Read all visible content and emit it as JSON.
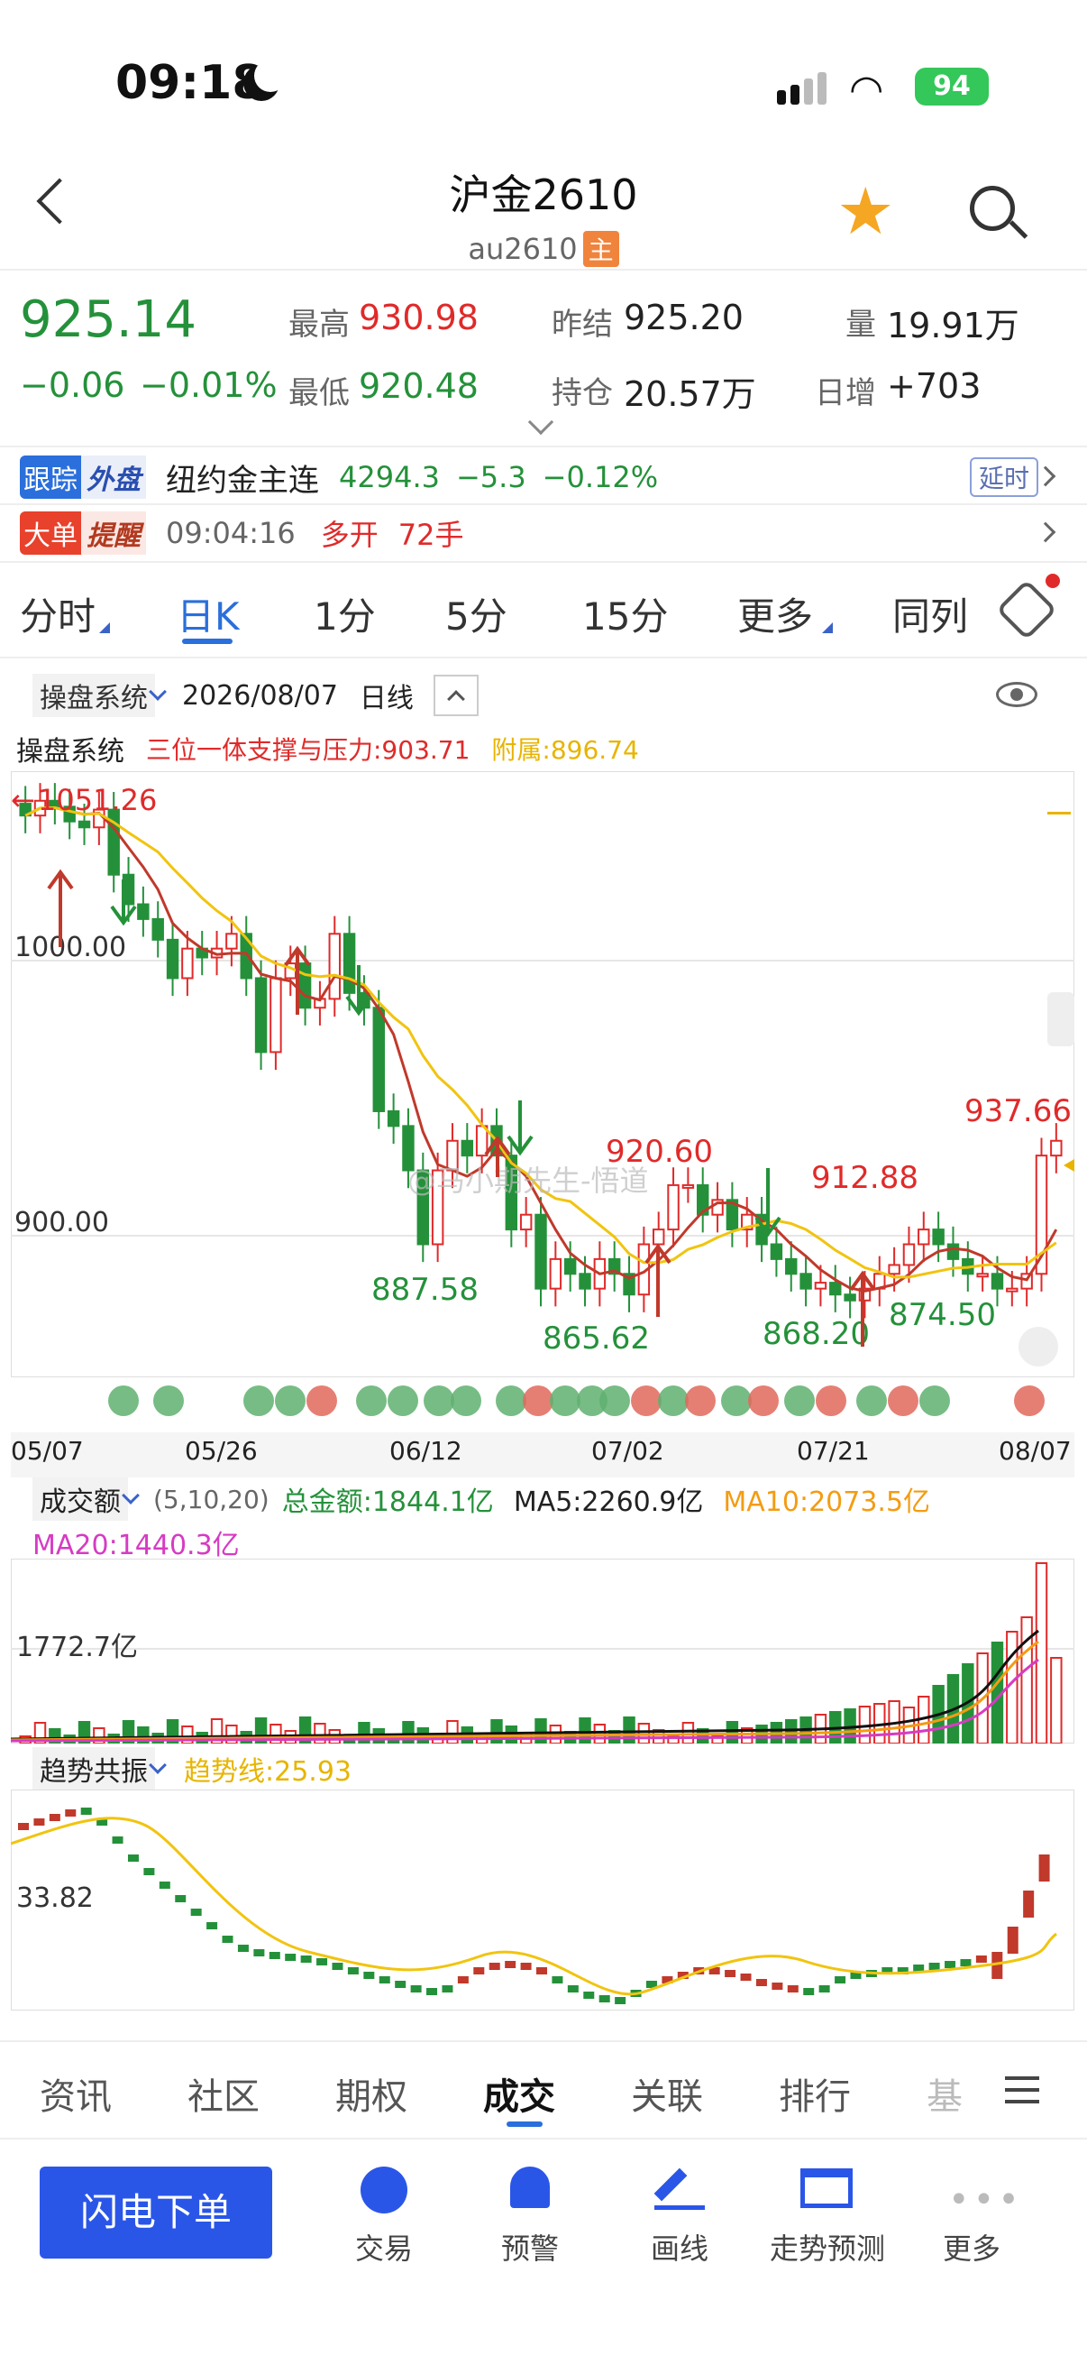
{
  "status": {
    "time": "09:18",
    "battery": "94"
  },
  "header": {
    "title": "沪金2610",
    "code": "au2610",
    "badge": "主"
  },
  "quote": {
    "price": "925.14",
    "change": "−0.06",
    "change_pct": "−0.01%",
    "high_label": "最高",
    "high": "930.98",
    "low_label": "最低",
    "low": "920.48",
    "prev_label": "昨结",
    "prev": "925.20",
    "oi_label": "持仓",
    "oi": "20.57万",
    "vol_label": "量",
    "vol": "19.91万",
    "inc_label": "日增",
    "inc": "+703"
  },
  "ticker": {
    "badge1a": "跟踪",
    "badge1b": "外盘",
    "name": "纽约金主连",
    "price": "4294.3",
    "change": "−5.3",
    "pct": "−0.12%",
    "delay": "延时",
    "badge2a": "大单",
    "badge2b": "提醒",
    "time": "09:04:16",
    "type": "多开",
    "qty": "72手"
  },
  "tabs": [
    "分时",
    "日K",
    "1分",
    "5分",
    "15分",
    "更多",
    "同列"
  ],
  "chart_bar": {
    "system": "操盘系统",
    "date": "2026/08/07",
    "period": "日线"
  },
  "indicator": {
    "name": "操盘系统",
    "support": "三位一体支撑与压力:903.71",
    "aux": "附属:896.74"
  },
  "chart_labels": {
    "max": "1051.26",
    "y1000": "1000.00",
    "y900": "900.00",
    "p1": "887.58",
    "p2": "865.62",
    "p3": "920.60",
    "p4": "912.88",
    "p5": "868.20",
    "p6": "874.50",
    "p7": "937.66",
    "watermark": "@马小期先生-悟道"
  },
  "dates": [
    "05/07",
    "05/26",
    "06/12",
    "07/02",
    "07/21",
    "08/07"
  ],
  "vol_panel": {
    "name": "成交额",
    "params": "(5,10,20)",
    "total": "总金额:1844.1亿",
    "ma5": "MA5:2260.9亿",
    "ma10": "MA10:2073.5亿",
    "ma20": "MA20:1440.3亿",
    "level": "1772.7亿"
  },
  "trend_panel": {
    "name": "趋势共振",
    "line": "趋势线:25.93",
    "level": "33.82"
  },
  "bottom_tabs": [
    "资讯",
    "社区",
    "期权",
    "成交",
    "关联",
    "排行",
    "基"
  ],
  "actions": {
    "order": "闪电下单",
    "trade": "交易",
    "alert": "预警",
    "draw": "画线",
    "forecast": "走势预测",
    "more": "更多"
  },
  "chart_data": {
    "type": "candlestick",
    "x_start": "05/07",
    "x_end": "08/07",
    "ylim": [
      850,
      1055
    ],
    "annotations": {
      "max": 1051.26,
      "lows": [
        887.58,
        865.62,
        868.2,
        874.5
      ],
      "highs": [
        920.6,
        912.88,
        937.66
      ]
    },
    "closes": [
      1040,
      1045,
      1043,
      1038,
      1036,
      1042,
      1020,
      1010,
      1005,
      998,
      985,
      995,
      992,
      995,
      1000,
      985,
      960,
      985,
      990,
      975,
      978,
      1000,
      980,
      975,
      940,
      935,
      920,
      895,
      920,
      930,
      925,
      935,
      925,
      900,
      905,
      880,
      890,
      885,
      880,
      890,
      885,
      878,
      895,
      900,
      915,
      915,
      905,
      910,
      900,
      905,
      895,
      890,
      885,
      880,
      882,
      878,
      876,
      880,
      885,
      888,
      895,
      900,
      895,
      890,
      885,
      885,
      880,
      880,
      885,
      925,
      930
    ],
    "colors": {
      "up": "#e02a2a",
      "down": "#24913a",
      "ma1": "#c0392b",
      "ma2": "#f1c40f"
    }
  }
}
